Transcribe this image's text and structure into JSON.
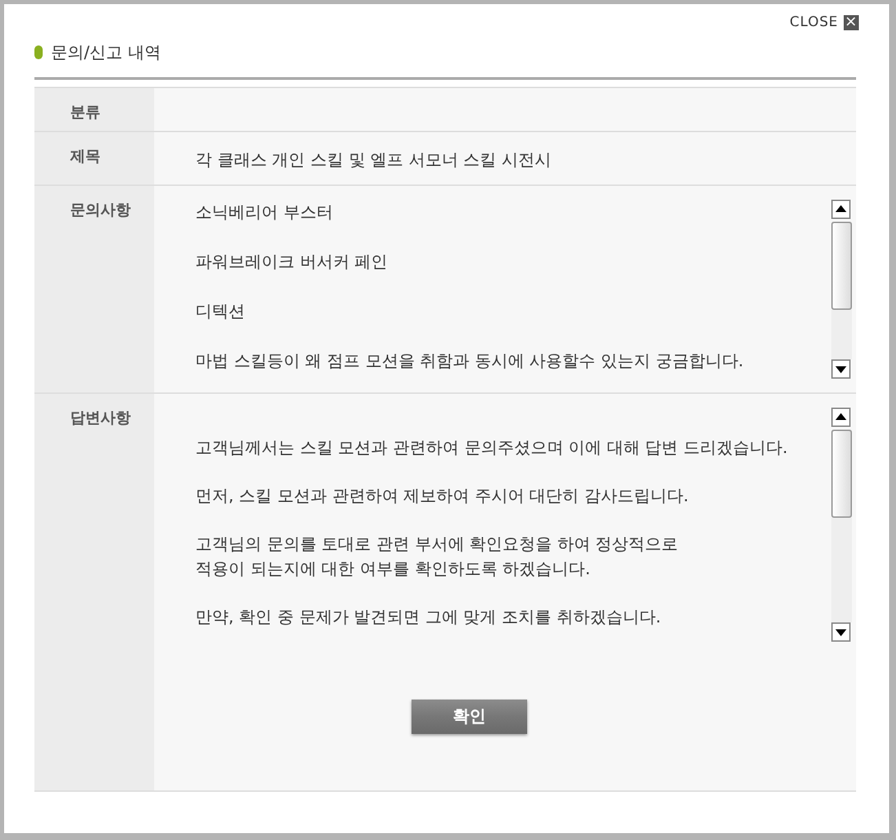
{
  "close": {
    "label": "CLOSE",
    "icon": "×"
  },
  "title": "문의/신고 내역",
  "rows": [
    {
      "label": "분류",
      "kind": "text"
    },
    {
      "label": "제목",
      "kind": "text",
      "value": "각 클래스 개인 스킬 및 엘프 서모너 스킬 시전시"
    },
    {
      "label": "문의사항",
      "kind": "scroll",
      "paragraphs": [
        "소닉베리어 부스터",
        "파워브레이크 버서커 페인",
        "디텍션",
        "마법 스킬등이 왜 점프 모션을 취함과 동시에 사용할수 있는지 궁금합니다."
      ]
    },
    {
      "label": "답변사항",
      "kind": "answer",
      "paragraphs": [
        "고객님께서는 스킬 모션과 관련하여 문의주셨으며 이에 대해 답변 드리겠습니다.",
        "먼저, 스킬 모션과 관련하여 제보하여 주시어 대단히 감사드립니다.",
        "고객님의 문의를 토대로 관련 부서에 확인요청을 하여 정상적으로\n적용이 되는지에 대한 여부를 확인하도록 하겠습니다.",
        "만약, 확인 중 문제가 발견되면 그에 맞게 조치를 취하겠습니다."
      ],
      "button": "확인"
    }
  ]
}
